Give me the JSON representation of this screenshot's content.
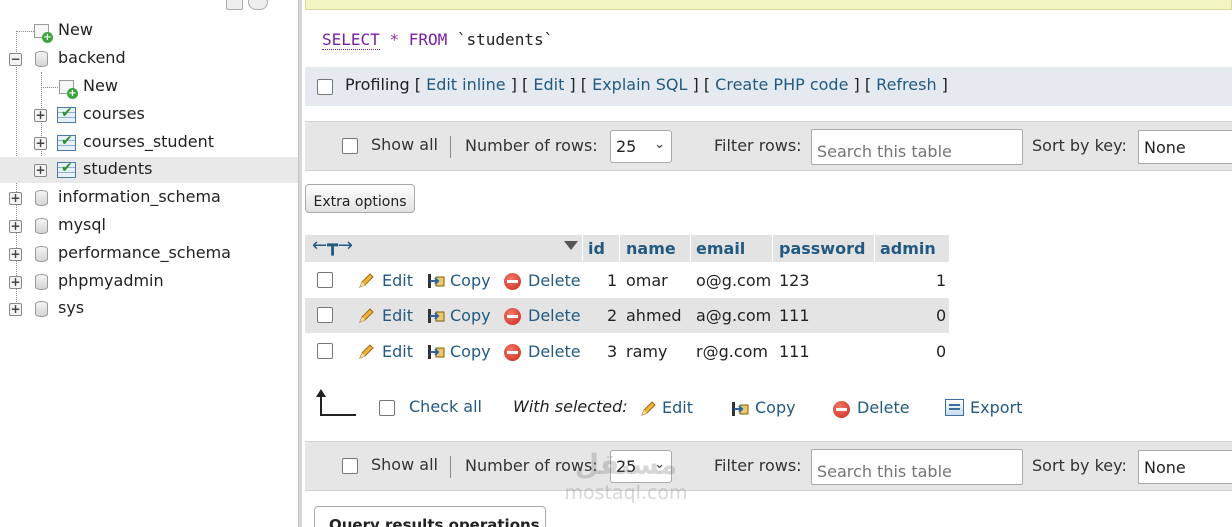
{
  "nav": {
    "items": [
      {
        "label": "New",
        "kind": "new"
      },
      {
        "label": "backend",
        "kind": "db",
        "expanded": true
      },
      {
        "label": "New",
        "kind": "new"
      },
      {
        "label": "courses",
        "kind": "table"
      },
      {
        "label": "courses_student",
        "kind": "table"
      },
      {
        "label": "students",
        "kind": "table",
        "selected": true
      },
      {
        "label": "information_schema",
        "kind": "db"
      },
      {
        "label": "mysql",
        "kind": "db"
      },
      {
        "label": "performance_schema",
        "kind": "db"
      },
      {
        "label": "phpmyadmin",
        "kind": "db"
      },
      {
        "label": "sys",
        "kind": "db"
      }
    ]
  },
  "query": {
    "select_kw": "SELECT",
    "star": "*",
    "from_kw": "FROM",
    "table": "`students`"
  },
  "profiling": {
    "label": "Profiling",
    "links": [
      "Edit inline",
      "Edit",
      "Explain SQL",
      "Create PHP code",
      "Refresh"
    ]
  },
  "navbar": {
    "show_all": "Show all",
    "rows_label": "Number of rows:",
    "rows_value": "25",
    "filter_label": "Filter rows:",
    "filter_placeholder": "Search this table",
    "sort_label": "Sort by key:",
    "sort_value": "None"
  },
  "extra_options": "Extra options",
  "table": {
    "columns": [
      "id",
      "name",
      "email",
      "password",
      "admin"
    ],
    "actions": {
      "edit": "Edit",
      "copy": "Copy",
      "delete": "Delete"
    },
    "rows": [
      {
        "id": "1",
        "name": "omar",
        "email": "o@g.com",
        "password": "123",
        "admin": "1"
      },
      {
        "id": "2",
        "name": "ahmed",
        "email": "a@g.com",
        "password": "111",
        "admin": "0"
      },
      {
        "id": "3",
        "name": "ramy",
        "email": "r@g.com",
        "password": "111",
        "admin": "0"
      }
    ]
  },
  "bulk": {
    "check_all": "Check all",
    "with_selected": "With selected:",
    "edit": "Edit",
    "copy": "Copy",
    "delete": "Delete",
    "export": "Export"
  },
  "query_results_operations": "Query results operations",
  "watermark": {
    "arabic": "مستقل",
    "latin": "mostaql.com"
  },
  "colors": {
    "link": "#235a81",
    "keyword": "#7a1fa2",
    "bar_bg": "#e6e6e6",
    "profiling_bg": "#e4eaf0",
    "alt_row": "#e4e4e4"
  }
}
